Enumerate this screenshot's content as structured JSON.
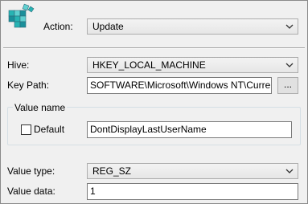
{
  "header": {
    "icon": "registry-cubes-icon",
    "action_label": "Action:",
    "action_value": "Update"
  },
  "form": {
    "hive_label": "Hive:",
    "hive_value": "HKEY_LOCAL_MACHINE",
    "key_path_label": "Key Path:",
    "key_path_value": "SOFTWARE\\Microsoft\\Windows NT\\CurrentVer",
    "browse_label": "...",
    "value_name_group_label": "Value name",
    "default_label": "Default",
    "default_checked": false,
    "value_name_value": "DontDisplayLastUserName",
    "value_type_label": "Value type:",
    "value_type_value": "REG_SZ",
    "value_data_label": "Value data:",
    "value_data_value": "1"
  },
  "colors": {
    "background": "#f0f0f0",
    "border": "#adadad",
    "icon_teal": "#1aa3a3"
  }
}
